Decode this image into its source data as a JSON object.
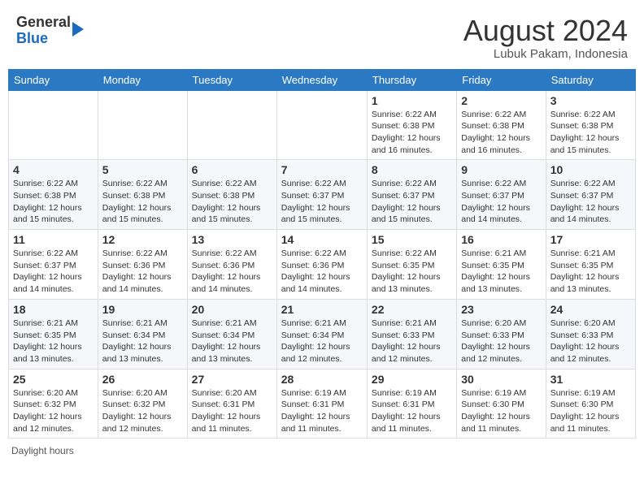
{
  "header": {
    "logo_line1": "General",
    "logo_line2": "Blue",
    "month_title": "August 2024",
    "location": "Lubuk Pakam, Indonesia"
  },
  "weekdays": [
    "Sunday",
    "Monday",
    "Tuesday",
    "Wednesday",
    "Thursday",
    "Friday",
    "Saturday"
  ],
  "footer": "Daylight hours",
  "weeks": [
    [
      {
        "day": "",
        "info": ""
      },
      {
        "day": "",
        "info": ""
      },
      {
        "day": "",
        "info": ""
      },
      {
        "day": "",
        "info": ""
      },
      {
        "day": "1",
        "info": "Sunrise: 6:22 AM\nSunset: 6:38 PM\nDaylight: 12 hours and 16 minutes."
      },
      {
        "day": "2",
        "info": "Sunrise: 6:22 AM\nSunset: 6:38 PM\nDaylight: 12 hours and 16 minutes."
      },
      {
        "day": "3",
        "info": "Sunrise: 6:22 AM\nSunset: 6:38 PM\nDaylight: 12 hours and 15 minutes."
      }
    ],
    [
      {
        "day": "4",
        "info": "Sunrise: 6:22 AM\nSunset: 6:38 PM\nDaylight: 12 hours and 15 minutes."
      },
      {
        "day": "5",
        "info": "Sunrise: 6:22 AM\nSunset: 6:38 PM\nDaylight: 12 hours and 15 minutes."
      },
      {
        "day": "6",
        "info": "Sunrise: 6:22 AM\nSunset: 6:38 PM\nDaylight: 12 hours and 15 minutes."
      },
      {
        "day": "7",
        "info": "Sunrise: 6:22 AM\nSunset: 6:37 PM\nDaylight: 12 hours and 15 minutes."
      },
      {
        "day": "8",
        "info": "Sunrise: 6:22 AM\nSunset: 6:37 PM\nDaylight: 12 hours and 15 minutes."
      },
      {
        "day": "9",
        "info": "Sunrise: 6:22 AM\nSunset: 6:37 PM\nDaylight: 12 hours and 14 minutes."
      },
      {
        "day": "10",
        "info": "Sunrise: 6:22 AM\nSunset: 6:37 PM\nDaylight: 12 hours and 14 minutes."
      }
    ],
    [
      {
        "day": "11",
        "info": "Sunrise: 6:22 AM\nSunset: 6:37 PM\nDaylight: 12 hours and 14 minutes."
      },
      {
        "day": "12",
        "info": "Sunrise: 6:22 AM\nSunset: 6:36 PM\nDaylight: 12 hours and 14 minutes."
      },
      {
        "day": "13",
        "info": "Sunrise: 6:22 AM\nSunset: 6:36 PM\nDaylight: 12 hours and 14 minutes."
      },
      {
        "day": "14",
        "info": "Sunrise: 6:22 AM\nSunset: 6:36 PM\nDaylight: 12 hours and 14 minutes."
      },
      {
        "day": "15",
        "info": "Sunrise: 6:22 AM\nSunset: 6:35 PM\nDaylight: 12 hours and 13 minutes."
      },
      {
        "day": "16",
        "info": "Sunrise: 6:21 AM\nSunset: 6:35 PM\nDaylight: 12 hours and 13 minutes."
      },
      {
        "day": "17",
        "info": "Sunrise: 6:21 AM\nSunset: 6:35 PM\nDaylight: 12 hours and 13 minutes."
      }
    ],
    [
      {
        "day": "18",
        "info": "Sunrise: 6:21 AM\nSunset: 6:35 PM\nDaylight: 12 hours and 13 minutes."
      },
      {
        "day": "19",
        "info": "Sunrise: 6:21 AM\nSunset: 6:34 PM\nDaylight: 12 hours and 13 minutes."
      },
      {
        "day": "20",
        "info": "Sunrise: 6:21 AM\nSunset: 6:34 PM\nDaylight: 12 hours and 13 minutes."
      },
      {
        "day": "21",
        "info": "Sunrise: 6:21 AM\nSunset: 6:34 PM\nDaylight: 12 hours and 12 minutes."
      },
      {
        "day": "22",
        "info": "Sunrise: 6:21 AM\nSunset: 6:33 PM\nDaylight: 12 hours and 12 minutes."
      },
      {
        "day": "23",
        "info": "Sunrise: 6:20 AM\nSunset: 6:33 PM\nDaylight: 12 hours and 12 minutes."
      },
      {
        "day": "24",
        "info": "Sunrise: 6:20 AM\nSunset: 6:33 PM\nDaylight: 12 hours and 12 minutes."
      }
    ],
    [
      {
        "day": "25",
        "info": "Sunrise: 6:20 AM\nSunset: 6:32 PM\nDaylight: 12 hours and 12 minutes."
      },
      {
        "day": "26",
        "info": "Sunrise: 6:20 AM\nSunset: 6:32 PM\nDaylight: 12 hours and 12 minutes."
      },
      {
        "day": "27",
        "info": "Sunrise: 6:20 AM\nSunset: 6:31 PM\nDaylight: 12 hours and 11 minutes."
      },
      {
        "day": "28",
        "info": "Sunrise: 6:19 AM\nSunset: 6:31 PM\nDaylight: 12 hours and 11 minutes."
      },
      {
        "day": "29",
        "info": "Sunrise: 6:19 AM\nSunset: 6:31 PM\nDaylight: 12 hours and 11 minutes."
      },
      {
        "day": "30",
        "info": "Sunrise: 6:19 AM\nSunset: 6:30 PM\nDaylight: 12 hours and 11 minutes."
      },
      {
        "day": "31",
        "info": "Sunrise: 6:19 AM\nSunset: 6:30 PM\nDaylight: 12 hours and 11 minutes."
      }
    ]
  ]
}
